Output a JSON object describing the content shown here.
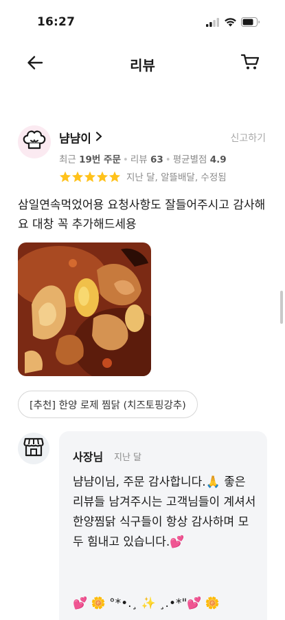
{
  "status_bar": {
    "time": "16:27",
    "icons": [
      "signal-icon",
      "wifi-icon",
      "battery-icon"
    ]
  },
  "nav": {
    "title": "리뷰",
    "back_icon": "arrow-left-icon",
    "cart_icon": "cart-icon"
  },
  "review": {
    "author": "냠냠이",
    "report_label": "신고하기",
    "recent_orders_label": "최근",
    "recent_orders_value": "19번 주문",
    "reviews_label": "리뷰",
    "reviews_value": "63",
    "avg_label": "평균별점",
    "avg_value": "4.9",
    "rating_stars": 5,
    "rating_detail": "지난 달, 알뜰배달, 수정됨",
    "text": "삼일연속먹었어용 요청사항도 잘들어주시고 감사해요 대창 꼭 추가해드세용",
    "menu_chip": "[추천] 한양 로제 찜닭 (치즈토핑강추)"
  },
  "owner_reply": {
    "name": "사장님",
    "date": "지난 달",
    "text": "냠냠이님,  주문 감사합니다.🙏 좋은 리뷰들 남겨주시는 고객님들이 계셔서 한양찜닭 식구들이 항상 감사하며 모두 힘내고 있습니다.💕",
    "decoration": "💕 🌼 °*•.¸ ✨ ¸.•*\"💕 🌼"
  },
  "colors": {
    "star": "#ffc21b",
    "muted": "#8a8a8a",
    "reply_bg": "#f4f5f7"
  }
}
